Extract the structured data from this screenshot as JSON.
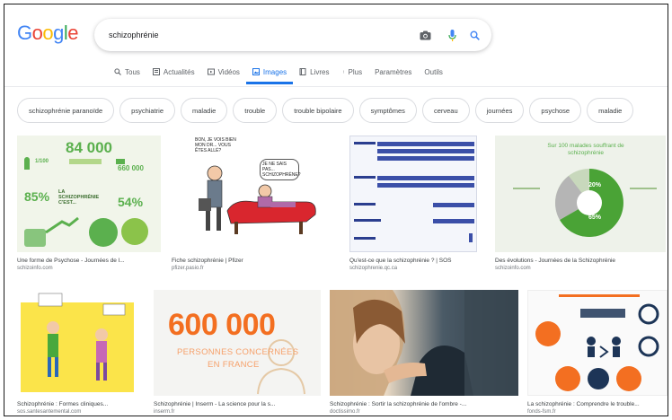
{
  "search": {
    "query": "schizophrénie",
    "camera_icon": "camera-icon",
    "mic_icon": "mic-icon",
    "search_icon": "search-icon"
  },
  "logo": {
    "text": "Google"
  },
  "tabs": [
    {
      "label": "Tous",
      "icon": "search-icon",
      "active": false
    },
    {
      "label": "Actualités",
      "icon": "news-icon",
      "active": false
    },
    {
      "label": "Vidéos",
      "icon": "video-icon",
      "active": false
    },
    {
      "label": "Images",
      "icon": "image-icon",
      "active": true
    },
    {
      "label": "Livres",
      "icon": "book-icon",
      "active": false
    },
    {
      "label": "Plus",
      "icon": "more-icon",
      "active": false
    },
    {
      "label": "Paramètres",
      "active": false
    },
    {
      "label": "Outils",
      "active": false
    }
  ],
  "chips": [
    "schizophrénie paranoïde",
    "psychiatrie",
    "maladie",
    "trouble",
    "trouble bipolaire",
    "symptômes",
    "cerveau",
    "journées",
    "psychose",
    "maladie"
  ],
  "results": [
    {
      "caption": "Une forme de Psychose - Journées de l...",
      "source": "schizoinfo.com",
      "stat_big": "84 000",
      "stat_pct1": "85%",
      "stat_pct2": "54%",
      "stat_small": "1/100",
      "stat_count": "660 000",
      "headline": "LA SCHIZOPHRÉNIE C'EST..."
    },
    {
      "caption": "Fiche schizophrénie | Pfizer",
      "source": "pfizer.pasio.fr",
      "bubble1": "BON, JE VOIS BIEN MON DR... VOUS ÊTES ALLÉ?",
      "bubble2": "JE NE SAIS PAS... SCHIZOPHRÈNE?"
    },
    {
      "caption": "Qu'est-ce que la schizophrénie ? | SOS",
      "source": "schizophrenie.qc.ca"
    },
    {
      "caption": "Des évolutions - Journées de la Schizophrénie",
      "source": "schizoinfo.com",
      "title": "Sur 100 malades souffrant de schizophrénie",
      "pct1": "20%",
      "pct2": "65%"
    },
    {
      "caption": "Schizophrénie : Formes cliniques...",
      "source": "sos.santesantemental.com"
    },
    {
      "caption": "Schizophrénie | Inserm - La science pour la s...",
      "source": "inserm.fr",
      "big_number": "600 000",
      "line1": "PERSONNES CONCERNÉES",
      "line2": "EN FRANCE"
    },
    {
      "caption": "Schizophrénie : Sortir la schizophrénie de l'ombre -...",
      "source": "doctissimo.fr"
    },
    {
      "caption": "La schizophrénie : Comprendre le trouble...",
      "source": "fonds-fsm.fr"
    }
  ],
  "colors": {
    "accent": "#1a73e8",
    "green": "#5bb04e",
    "orange": "#f36f21"
  }
}
